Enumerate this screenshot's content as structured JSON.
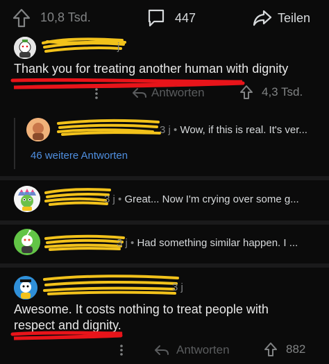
{
  "post_bar": {
    "upvotes": "10,8 Tsd.",
    "comments": "447",
    "share_label": "Teilen"
  },
  "comment1": {
    "author_suffix": "j",
    "text": "Thank you for treating another human with dignity",
    "reply_label": "Antworten",
    "score": "4,3 Tsd.",
    "reply": {
      "time": "3 j",
      "preview": "Wow, if this is real. It's ver..."
    },
    "more_replies": "46 weitere Antworten"
  },
  "comment2": {
    "time": "3 j",
    "preview": "Great... Now I'm crying over some g..."
  },
  "comment3": {
    "time": "3 j",
    "preview": "Had something similar happen. I ..."
  },
  "comment4": {
    "time": "3 j",
    "text_line1": "Awesome. It costs nothing to treat people with",
    "text_line2": "respect and dignity.",
    "reply_label": "Antworten",
    "score": "882"
  },
  "colors": {
    "background": "#0b0b0b",
    "redaction_yellow": "#f2c21b",
    "underline_red": "#e8141a",
    "link_blue": "#4f8fe0"
  }
}
